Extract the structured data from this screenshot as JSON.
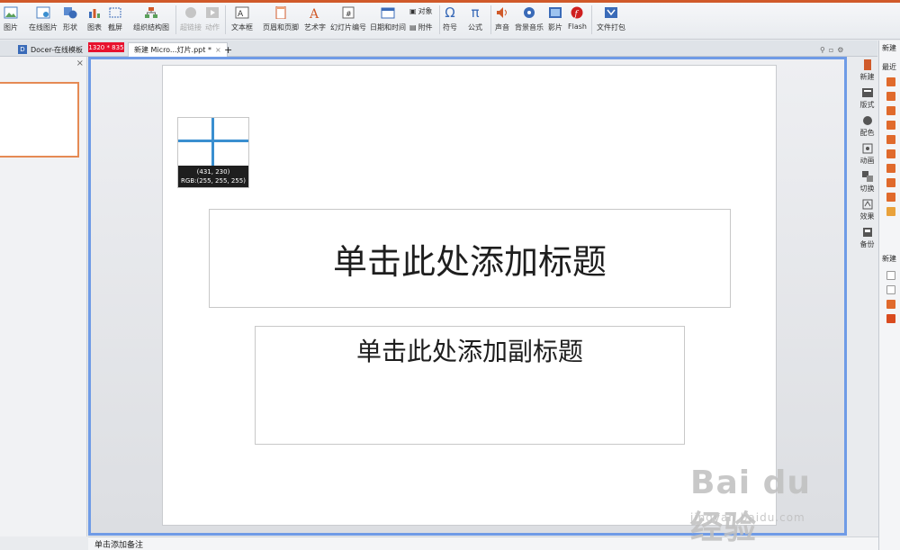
{
  "ribbon": {
    "buttons": [
      {
        "label": "图片",
        "icon": "picture-icon",
        "enabled": true
      },
      {
        "label": "在线图片",
        "icon": "online-picture-icon",
        "enabled": true
      },
      {
        "label": "形状",
        "icon": "shapes-icon",
        "enabled": true
      },
      {
        "label": "图表",
        "icon": "chart-icon",
        "enabled": true
      },
      {
        "label": "截屏",
        "icon": "screenshot-icon",
        "enabled": true
      },
      {
        "label": "组织结构图",
        "icon": "org-chart-icon",
        "enabled": true
      },
      {
        "label": "超链接",
        "icon": "hyperlink-icon",
        "enabled": false
      },
      {
        "label": "动作",
        "icon": "action-icon",
        "enabled": false
      },
      {
        "label": "文本框",
        "icon": "textbox-icon",
        "enabled": true
      },
      {
        "label": "页眉和页脚",
        "icon": "header-footer-icon",
        "enabled": true
      },
      {
        "label": "艺术字",
        "icon": "wordart-icon",
        "enabled": true
      },
      {
        "label": "幻灯片编号",
        "icon": "slide-number-icon",
        "enabled": true
      },
      {
        "label": "日期和时间",
        "icon": "date-time-icon",
        "enabled": true
      },
      {
        "label": "符号",
        "icon": "symbol-icon",
        "enabled": true
      },
      {
        "label": "公式",
        "icon": "formula-icon",
        "enabled": true
      },
      {
        "label": "声音",
        "icon": "sound-icon",
        "enabled": true
      },
      {
        "label": "背景音乐",
        "icon": "background-music-icon",
        "enabled": true
      },
      {
        "label": "影片",
        "icon": "movie-icon",
        "enabled": true
      },
      {
        "label": "Flash",
        "icon": "flash-icon",
        "enabled": true
      },
      {
        "label": "文件打包",
        "icon": "file-package-icon",
        "enabled": true
      }
    ],
    "object_label": "对象",
    "attachment_label": "附件"
  },
  "tabs": {
    "docer": "Docer-在线模板",
    "doc": "新建 Micro...灯片.ppt *",
    "add": "+"
  },
  "dimension_badge": "1320 * 835",
  "magnifier": {
    "coords": "(431, 230)",
    "rgb": "RGB:(255, 255, 255)"
  },
  "slide": {
    "title_placeholder": "单击此处添加标题",
    "subtitle_placeholder": "单击此处添加副标题"
  },
  "notes_placeholder": "单击添加备注",
  "side_toolbar": [
    {
      "label": "新建",
      "icon": "new-icon"
    },
    {
      "label": "版式",
      "icon": "layout-icon"
    },
    {
      "label": "配色",
      "icon": "color-scheme-icon"
    },
    {
      "label": "动画",
      "icon": "animation-icon"
    },
    {
      "label": "切换",
      "icon": "transition-icon"
    },
    {
      "label": "效果",
      "icon": "effects-icon"
    },
    {
      "label": "备份",
      "icon": "backup-icon"
    }
  ],
  "task_pane": {
    "title": "新建",
    "recent_label": "最近",
    "new_label": "新建"
  },
  "watermark": {
    "main": "Bai du 经验",
    "sub": "jingyan.baidu.com"
  },
  "colors": {
    "accent_orange": "#d05a2a",
    "canvas_border": "#6f9be6",
    "badge_red": "#e8112d",
    "crosshair": "#3a8fd0"
  }
}
